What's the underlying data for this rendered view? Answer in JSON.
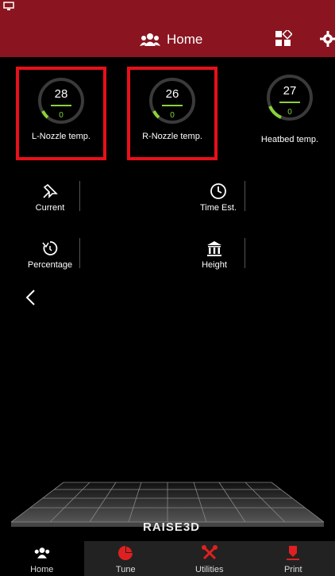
{
  "header": {
    "title": "Home"
  },
  "gauges": [
    {
      "value": "28",
      "setpoint": "0",
      "label": "L-Nozzle temp."
    },
    {
      "value": "26",
      "setpoint": "0",
      "label": "R-Nozzle temp."
    },
    {
      "value": "27",
      "setpoint": "0",
      "label": "Heatbed temp."
    }
  ],
  "stats": {
    "current": "Current",
    "time_est": "Time Est.",
    "percentage": "Percentage",
    "height": "Height"
  },
  "brand": "RAISE3D",
  "nav": [
    {
      "label": "Home"
    },
    {
      "label": "Tune"
    },
    {
      "label": "Utilities"
    },
    {
      "label": "Print"
    }
  ],
  "colors": {
    "header": "#8a1520",
    "accent": "#8ad23b",
    "highlight": "#e8101a",
    "nav_icon": "#e02020"
  }
}
